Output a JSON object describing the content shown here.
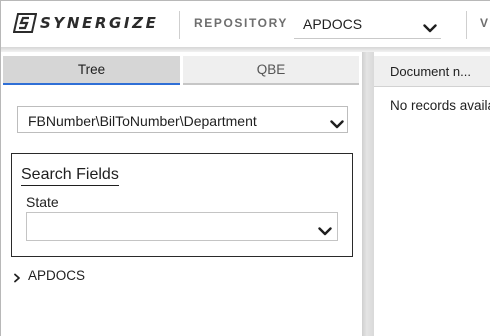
{
  "header": {
    "logo_text": "SYNERGIZE",
    "repository_label": "REPOSITORY",
    "repository_value": "APDOCS",
    "truncated_label": "V"
  },
  "left_panel": {
    "tabs": [
      {
        "label": "Tree",
        "active": true
      },
      {
        "label": "QBE",
        "active": false
      }
    ],
    "tree_select_value": "FBNumber\\BilToNumber\\Department",
    "search_fields": {
      "title": "Search Fields",
      "state_label": "State",
      "state_value": ""
    },
    "tree_nodes": [
      {
        "label": "APDOCS",
        "expanded": false
      }
    ]
  },
  "right_panel": {
    "column_header": "Document n...",
    "empty_message": "No records available"
  },
  "colors": {
    "accent": "#2f6fd6",
    "active_tab_bg": "#d6d6d6",
    "inactive_tab_bg": "#efefef",
    "splitter": "#d9d9d9"
  },
  "icons": [
    "synergize-logo-icon",
    "chevron-down-icon",
    "chevron-right-icon"
  ]
}
